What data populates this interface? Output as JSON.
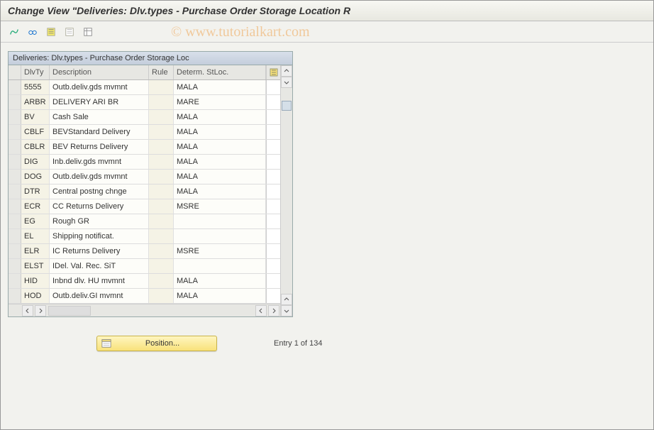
{
  "title": "Change View \"Deliveries: Dlv.types - Purchase Order Storage Location R",
  "watermark": "© www.tutorialkart.com",
  "panel_title": "Deliveries: Dlv.types - Purchase Order Storage Loc",
  "columns": {
    "dlvty": "DlvTy",
    "desc": "Description",
    "rule": "Rule",
    "stloc": "Determ. StLoc."
  },
  "rows": [
    {
      "dlvty": "5555",
      "desc": "Outb.deliv.gds mvmnt",
      "rule": "",
      "stloc": "MALA"
    },
    {
      "dlvty": "ARBR",
      "desc": "DELIVERY ARI BR",
      "rule": "",
      "stloc": "MARE"
    },
    {
      "dlvty": "BV",
      "desc": "Cash Sale",
      "rule": "",
      "stloc": "MALA"
    },
    {
      "dlvty": "CBLF",
      "desc": "BEVStandard Delivery",
      "rule": "",
      "stloc": "MALA"
    },
    {
      "dlvty": "CBLR",
      "desc": "BEV Returns Delivery",
      "rule": "",
      "stloc": "MALA"
    },
    {
      "dlvty": "DIG",
      "desc": "Inb.deliv.gds mvmnt",
      "rule": "",
      "stloc": "MALA"
    },
    {
      "dlvty": "DOG",
      "desc": "Outb.deliv.gds mvmnt",
      "rule": "",
      "stloc": "MALA"
    },
    {
      "dlvty": "DTR",
      "desc": "Central postng chnge",
      "rule": "",
      "stloc": "MALA"
    },
    {
      "dlvty": "ECR",
      "desc": "CC Returns Delivery",
      "rule": "",
      "stloc": "MSRE"
    },
    {
      "dlvty": "EG",
      "desc": "Rough GR",
      "rule": "",
      "stloc": ""
    },
    {
      "dlvty": "EL",
      "desc": "Shipping notificat.",
      "rule": "",
      "stloc": ""
    },
    {
      "dlvty": "ELR",
      "desc": "IC Returns Delivery",
      "rule": "",
      "stloc": "MSRE"
    },
    {
      "dlvty": "ELST",
      "desc": "IDel. Val. Rec. SiT",
      "rule": "",
      "stloc": ""
    },
    {
      "dlvty": "HID",
      "desc": "Inbnd dlv. HU mvmnt",
      "rule": "",
      "stloc": "MALA"
    },
    {
      "dlvty": "HOD",
      "desc": "Outb.deliv.GI mvmnt",
      "rule": "",
      "stloc": "MALA"
    }
  ],
  "position_label": "Position...",
  "entry_text": "Entry 1 of 134"
}
